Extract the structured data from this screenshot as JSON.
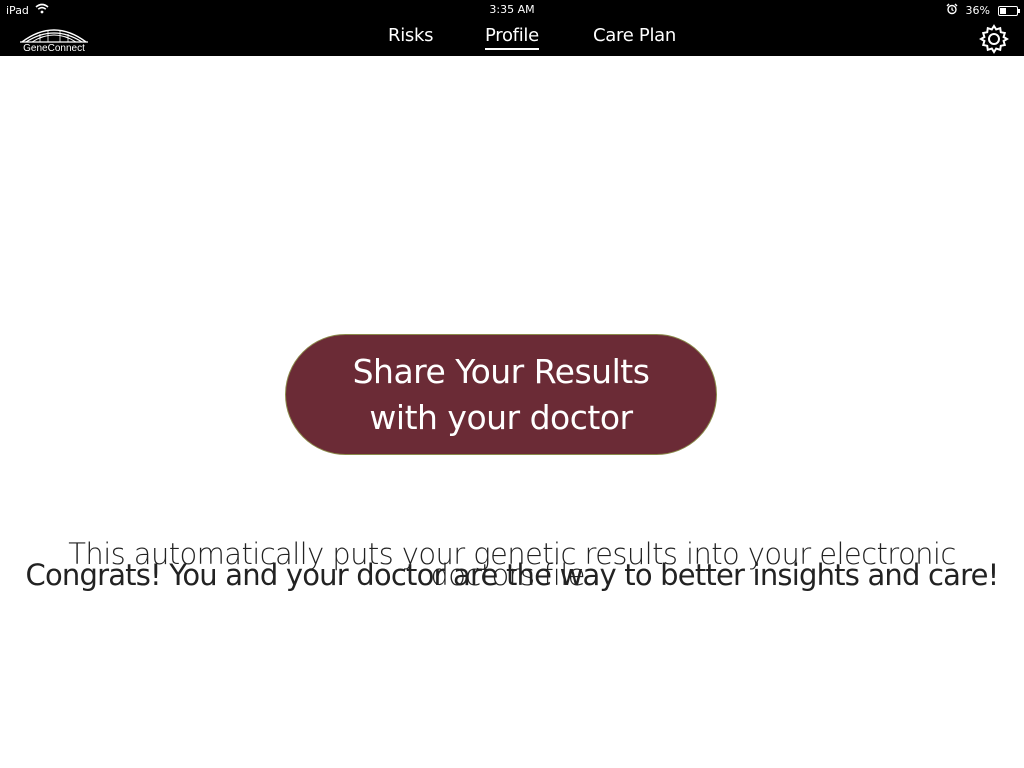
{
  "status_bar": {
    "device": "iPad",
    "time": "3:35 AM",
    "battery_percent": "36%",
    "battery_level": 0.36,
    "icons": [
      "wifi-icon",
      "alarm-icon",
      "battery-icon"
    ]
  },
  "nav": {
    "logo_text": "GeneConnect",
    "tabs": [
      {
        "label": "Risks"
      },
      {
        "label": "Profile",
        "active": true
      },
      {
        "label": "Care Plan"
      }
    ],
    "settings_icon": "gear-icon"
  },
  "main": {
    "share_button": {
      "line1": "Share Your Results",
      "line2": "with your doctor",
      "color": "#6b2b36"
    },
    "info_line1": "This automatically puts your genetic results into your electronic",
    "info_line2": "doctors file.",
    "congrats": "Congrats! You and your doctor are the way to better insights and care!"
  }
}
